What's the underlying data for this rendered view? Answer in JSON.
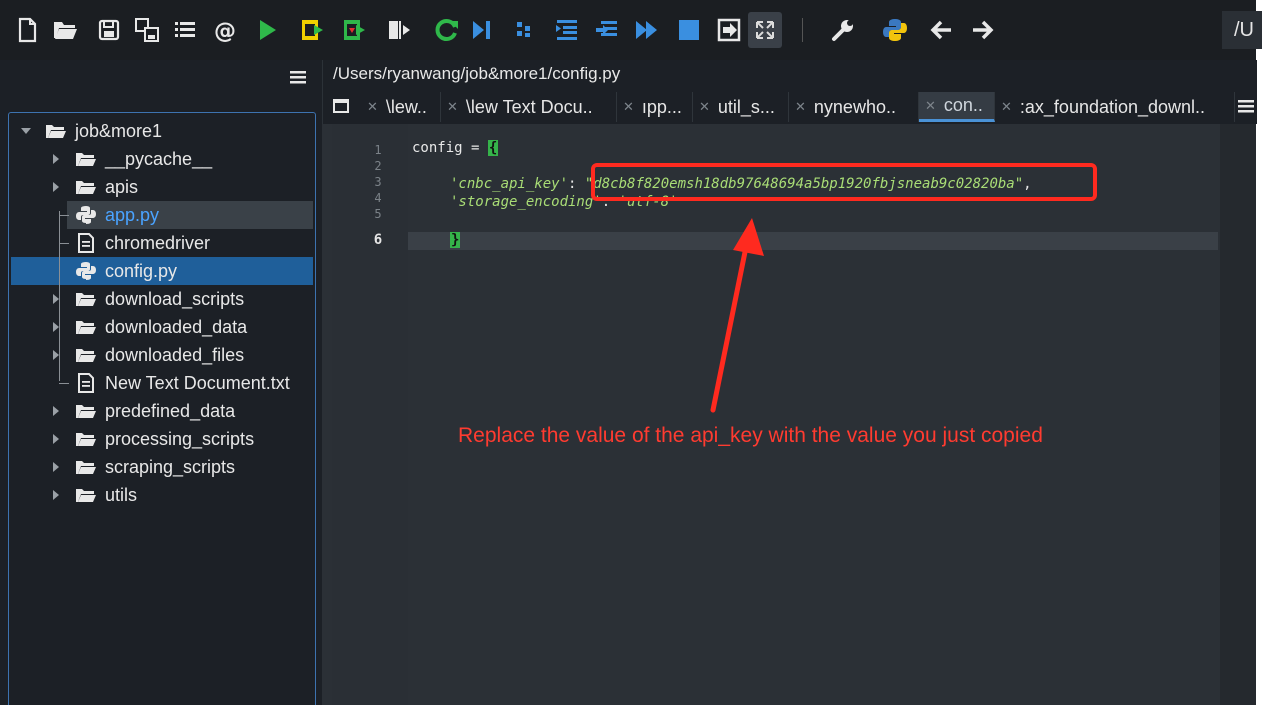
{
  "toolbar": {
    "buttons": [
      "new-file",
      "open-folder",
      "save",
      "save-all",
      "list-view",
      "at-sign",
      "run",
      "run-file",
      "debug-file",
      "step-into",
      "restart",
      "step",
      "step-over",
      "indent",
      "dedent",
      "continue",
      "stop",
      "exit-debug",
      "maximize",
      "settings-wrench",
      "python",
      "back",
      "forward"
    ],
    "cwd_fragment": "/U"
  },
  "path_bar": {
    "text": "/Users/ryanwang/job&more1/config.py"
  },
  "tabs": [
    {
      "label": "\\lew..",
      "active": false
    },
    {
      "label": "\\lew Text Docu..",
      "active": false
    },
    {
      "label": "ıpp...",
      "active": false
    },
    {
      "label": "util_s...",
      "active": false
    },
    {
      "label": "nynewho..",
      "active": false
    },
    {
      "label": "con..",
      "active": true
    },
    {
      "label": ":ax_foundation_downl..",
      "active": false
    }
  ],
  "file_tree": {
    "root": "job&more1",
    "items": [
      {
        "label": "__pycache__",
        "type": "folder"
      },
      {
        "label": "apis",
        "type": "folder"
      },
      {
        "label": "app.py",
        "type": "python",
        "state": "hover"
      },
      {
        "label": "chromedriver",
        "type": "file"
      },
      {
        "label": "config.py",
        "type": "python",
        "state": "selected"
      },
      {
        "label": "download_scripts",
        "type": "folder"
      },
      {
        "label": "downloaded_data",
        "type": "folder"
      },
      {
        "label": "downloaded_files",
        "type": "folder"
      },
      {
        "label": "New Text Document.txt",
        "type": "file"
      },
      {
        "label": "predefined_data",
        "type": "folder"
      },
      {
        "label": "processing_scripts",
        "type": "folder"
      },
      {
        "label": "scraping_scripts",
        "type": "folder"
      },
      {
        "label": "utils",
        "type": "folder"
      }
    ]
  },
  "editor": {
    "line_numbers": [
      "1",
      "2",
      "3",
      "4",
      "5",
      "6"
    ],
    "current_line": "6",
    "code": {
      "line1_var": "config",
      "line1_op": " = ",
      "line1_brace": "{",
      "line3_key": "'cnbc_api_key'",
      "line3_colon": ": ",
      "line3_value": "\"d8cb8f820emsh18db97648694a5bp1920fbjsneab9c02820ba\"",
      "line3_comma": ",",
      "line4_key": "'storage_encoding'",
      "line4_colon": ": ",
      "line4_value": "'utf-8'",
      "line6_brace": "}"
    }
  },
  "annotation": {
    "text": "Replace the value of the api_key with the value you just copied",
    "color": "#ff3b30"
  },
  "colors": {
    "accent_blue": "#1f5f9a",
    "string_green": "#a9dd76",
    "run_green": "#2fb84a"
  }
}
